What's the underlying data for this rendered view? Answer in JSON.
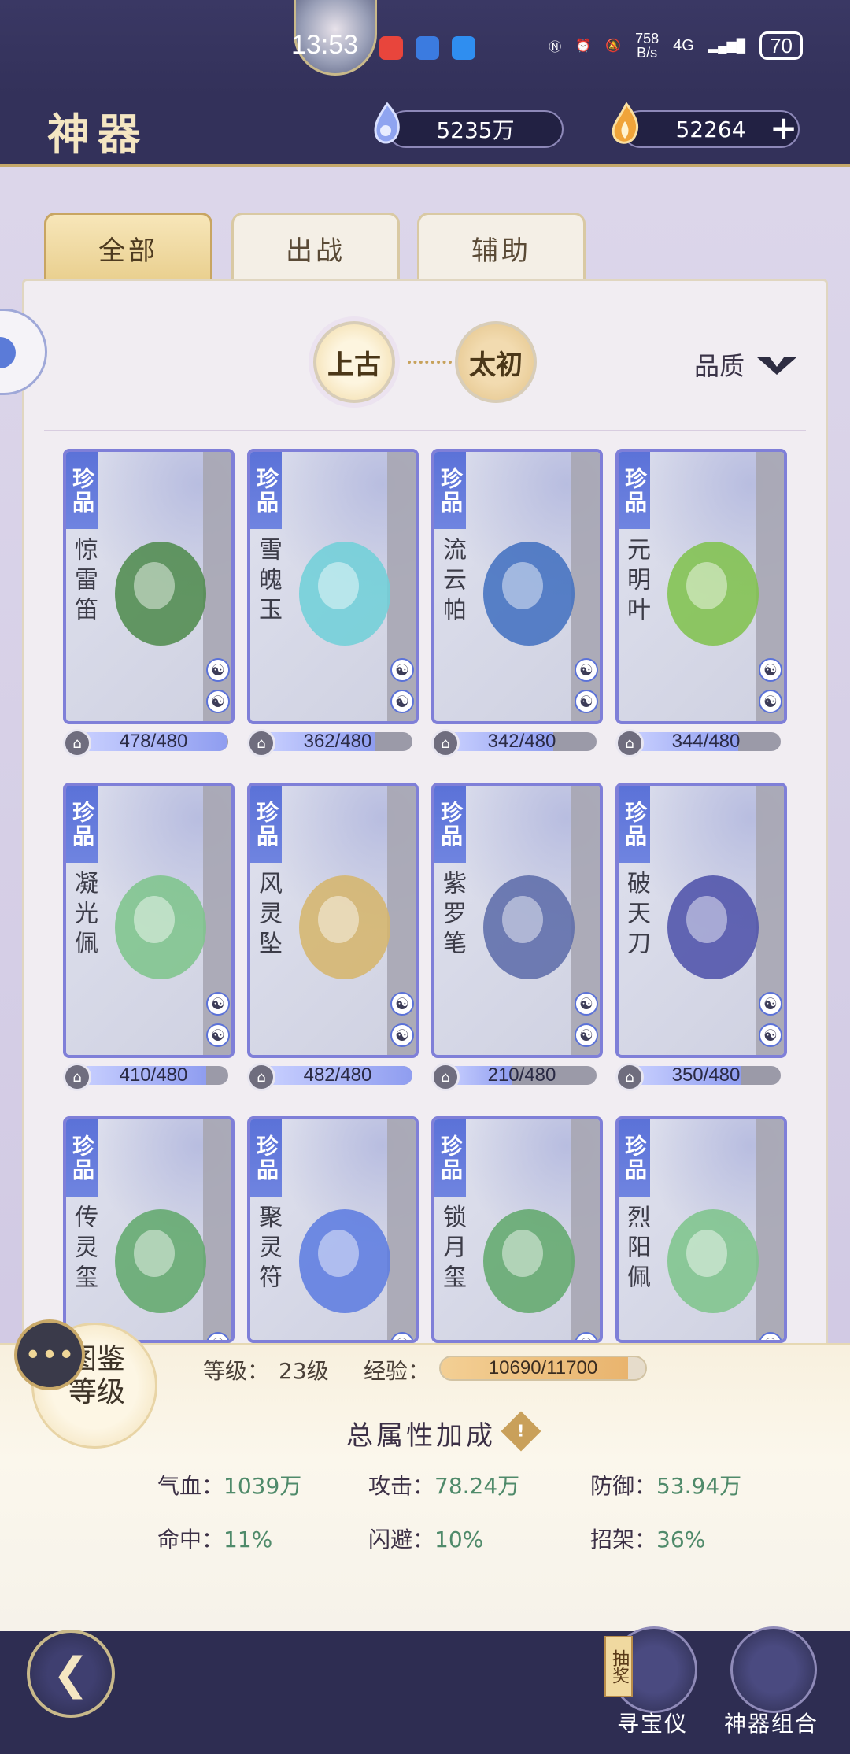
{
  "status": {
    "time": "13:53",
    "net_speed_top": "758",
    "net_speed_bottom": "B/s",
    "signal": "4G",
    "battery": "70"
  },
  "header": {
    "title": "神器",
    "currency_1": "5235万",
    "currency_2": "52264",
    "plus": "+"
  },
  "tabs": [
    {
      "label": "全部",
      "active": true
    },
    {
      "label": "出战",
      "active": false
    },
    {
      "label": "辅助",
      "active": false
    }
  ],
  "era": {
    "primary": "上古",
    "secondary": "太初"
  },
  "filter": {
    "quality_label": "品质"
  },
  "items": [
    {
      "grade": "珍品",
      "name": "惊雷笛",
      "progress": "478/480",
      "fill": 0.996
    },
    {
      "grade": "珍品",
      "name": "雪魄玉",
      "progress": "362/480",
      "fill": 0.754
    },
    {
      "grade": "珍品",
      "name": "流云帕",
      "progress": "342/480",
      "fill": 0.713
    },
    {
      "grade": "珍品",
      "name": "元明叶",
      "progress": "344/480",
      "fill": 0.717
    },
    {
      "grade": "珍品",
      "name": "凝光佩",
      "progress": "410/480",
      "fill": 0.854
    },
    {
      "grade": "珍品",
      "name": "风灵坠",
      "progress": "482/480",
      "fill": 1.0
    },
    {
      "grade": "珍品",
      "name": "紫罗笔",
      "progress": "210/480",
      "fill": 0.438
    },
    {
      "grade": "珍品",
      "name": "破天刀",
      "progress": "350/480",
      "fill": 0.729
    },
    {
      "grade": "珍品",
      "name": "传灵玺",
      "progress": "",
      "fill": 0
    },
    {
      "grade": "珍品",
      "name": "聚灵符",
      "progress": "",
      "fill": 0
    },
    {
      "grade": "珍品",
      "name": "锁月玺",
      "progress": "",
      "fill": 0
    },
    {
      "grade": "珍品",
      "name": "烈阳佩",
      "progress": "",
      "fill": 0
    }
  ],
  "collection": {
    "emblem": "图鉴等级",
    "level_label": "等级：",
    "level_value": "23级",
    "exp_label": "经验：",
    "exp_value": "10690/11700",
    "exp_fill": 0.914
  },
  "totals": {
    "title": "总属性加成",
    "stats": [
      {
        "label": "气血：",
        "value": "1039万"
      },
      {
        "label": "攻击：",
        "value": "78.24万"
      },
      {
        "label": "防御：",
        "value": "53.94万"
      },
      {
        "label": "命中：",
        "value": "11%"
      },
      {
        "label": "闪避：",
        "value": "10%"
      },
      {
        "label": "招架：",
        "value": "36%"
      }
    ]
  },
  "nav": {
    "lottery_badge": "抽奖",
    "treasure_label": "寻宝仪",
    "combo_label": "神器组合"
  },
  "colors": {
    "accent_gold": "#c9a562",
    "grade_blue": "#5b72d8",
    "stat_value_green": "#4f8a6a"
  }
}
